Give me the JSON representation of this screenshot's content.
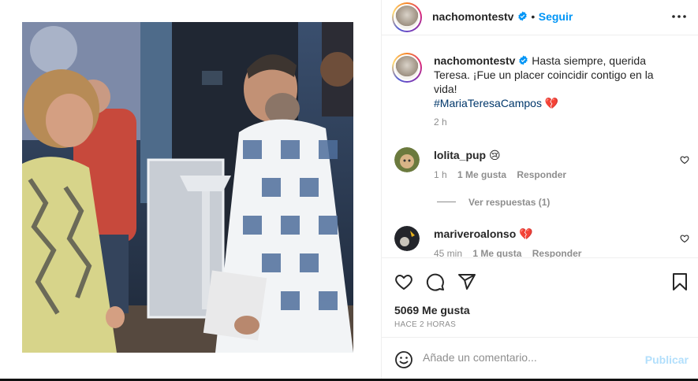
{
  "post": {
    "username": "nachomontestv",
    "follow_label": "Seguir",
    "separator": "•",
    "caption": "Hasta siempre, querida Teresa. ¡Fue un placer coincidir contigo en la vida!",
    "hashtag": "#MariaTeresaCampos",
    "hashtag_emoji": "💔",
    "caption_time": "2 h",
    "likes": "5069 Me gusta",
    "posted_ago": "HACE 2 HORAS"
  },
  "comments": [
    {
      "username": "lolita_pup",
      "text": "😢",
      "time": "1 h",
      "likes": "1 Me gusta",
      "reply": "Responder"
    },
    {
      "username": "mariveroalonso",
      "text": "💔",
      "time": "45 min",
      "likes": "1 Me gusta",
      "reply": "Responder"
    }
  ],
  "view_replies": "Ver respuestas (1)",
  "comment_box": {
    "placeholder": "Añade un comentario...",
    "publish_label": "Publicar"
  },
  "colors": {
    "follow_blue": "#0095f6",
    "hashtag_blue": "#00376b",
    "muted_gray": "#8e8e8e",
    "publish_disabled": "#b2dffc"
  }
}
